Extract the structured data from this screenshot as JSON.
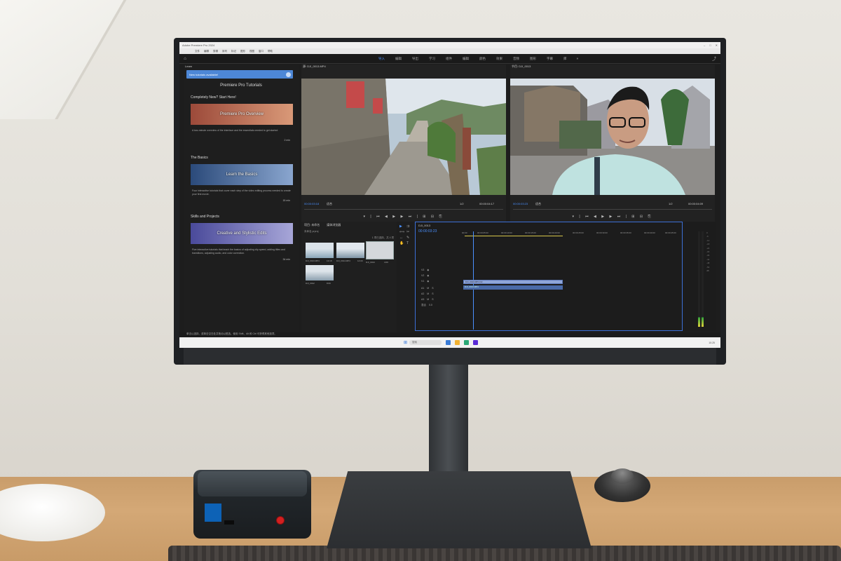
{
  "window": {
    "title": "Adobe Premiere Pro 2024",
    "menu": [
      "文件",
      "编辑",
      "剪辑",
      "序列",
      "标记",
      "图形",
      "视图",
      "窗口",
      "帮助"
    ]
  },
  "header": {
    "tabs": [
      "导入",
      "编辑",
      "导出"
    ],
    "active_tab_index": 0,
    "extra_tabs": [
      "学习",
      "组件",
      "编辑",
      "颜色",
      "效果",
      "音频",
      "图形",
      "字幕",
      "库"
    ]
  },
  "learn": {
    "panel_tab": "Learn",
    "banner": "New tutorials available!",
    "title": "Premiere Pro Tutorials",
    "sections": [
      {
        "heading": "Completely New? Start Here!",
        "card": "Premiere Pro Overview",
        "description": "A two-minute overview of the interface and the essentials needed to get started",
        "duration": "2 min",
        "color_a": "#9c4a3a",
        "color_b": "#d99978"
      },
      {
        "heading": "The Basics",
        "card": "Learn the Basics",
        "description": "Four interactive tutorials that cover each step of the video editing process needed to create your first movie.",
        "duration": "15 min",
        "color_a": "#2b4a7a",
        "color_b": "#8aa6cf"
      },
      {
        "heading": "Skills and Projects",
        "card": "Creative and Stylistic Edits",
        "description": "Five interactive tutorials that teach the basics of adjusting clip speed, adding titles and transitions, adjusting audio, and color correction.",
        "duration": "34 min",
        "color_a": "#4a4a9a",
        "color_b": "#a7a6d8"
      }
    ]
  },
  "source_monitor": {
    "tab": "源: DJI_0013.MP4",
    "timecode_in": "00:00:03:18",
    "fit": "适合",
    "scale": "1/2",
    "timecode_dur": "00:00:04:17",
    "controls": "▾ | ⏮ ◀ ▶ ▶ ⏭ | ⊞ ⊟ ⎘"
  },
  "program_monitor": {
    "tab": "节目: DJI_0013",
    "timecode_in": "00:00:03:23",
    "fit": "适合",
    "scale": "1/2",
    "timecode_dur": "00:00:04:09",
    "controls": "▾ | ⏮ ◀ ▶ ▶ ⏭ | ⊞ ⊟ ⎘"
  },
  "project": {
    "tabs": [
      "项目: 未命名",
      "媒体浏览器"
    ],
    "path": "未命名.prproj",
    "count": "1 项已选择，共 4 项",
    "items": [
      {
        "name": "DJI_0013.MP4",
        "dur": "13:18"
      },
      {
        "name": "DJI_0014.MP4",
        "dur": "14:00"
      },
      {
        "name": "DJI_0013",
        "dur": "4:09"
      },
      {
        "name": "DJI_0012",
        "dur": "8:09"
      }
    ]
  },
  "timeline": {
    "tab": "DJI_0013",
    "timecode": "00:00:03:23",
    "ruler": [
      "00:00",
      "00:00:05:00",
      "00:00:10:00",
      "00:00:15:00",
      "00:00:20:00",
      "00:00:25:00",
      "00:00:30:00",
      "00:00:35:00",
      "00:00:40:00",
      "00:00:45:00"
    ],
    "tracks": [
      "V3",
      "V2",
      "V1",
      "A1",
      "A2",
      "A3"
    ],
    "master_label": "混合",
    "master_value": "0.0",
    "video_clip": "DJI_0013.MP4 [V]",
    "audio_clip": "DJI_0013.MP4"
  },
  "meters": {
    "scale": [
      "0",
      "-6",
      "-12",
      "-18",
      "-24",
      "-30",
      "-36",
      "-42",
      "-48",
      "-54",
      "dB"
    ]
  },
  "status": {
    "text": "单击以选择，或单击空白处并拖动以框选。使用 Shift、Alt 和 Ctrl 可获得其他选项。"
  },
  "taskbar": {
    "search": "搜索",
    "time": "10:25"
  }
}
